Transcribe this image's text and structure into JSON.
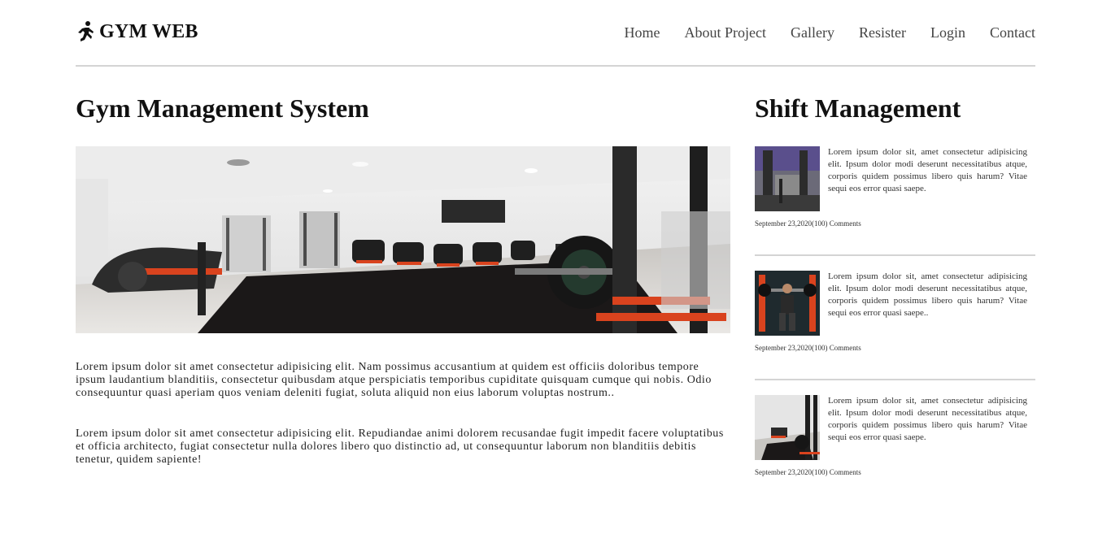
{
  "header": {
    "brand": "GYM WEB",
    "brand_icon": "running-person-icon",
    "nav": [
      "Home",
      "About Project",
      "Gallery",
      "Resister",
      "Login",
      "Contact"
    ]
  },
  "main": {
    "title": "Gym Management System",
    "paragraphs": [
      "Lorem ipsum dolor sit amet consectetur adipisicing elit. Nam possimus accusantium at quidem est officiis doloribus tempore ipsum laudantium blanditiis, consectetur quibusdam atque perspiciatis temporibus cupiditate quisquam cumque qui nobis. Odio consequuntur quasi aperiam quos veniam deleniti fugiat, soluta aliquid non eius laborum voluptas nostrum..",
      "Lorem ipsum dolor sit amet consectetur adipisicing elit. Repudiandae animi dolorem recusandae fugit impedit facere voluptatibus et officia architecto, fugiat consectetur nulla dolores libero quo distinctio ad, ut consequuntur laborum non blanditiis debitis tenetur, quidem sapiente!"
    ]
  },
  "sidebar": {
    "title": "Shift Management",
    "posts": [
      {
        "text": "Lorem ipsum dolor sit, amet consectetur adipisicing elit. Ipsum dolor modi deserunt necessitatibus atque, corporis quidem possimus libero quis harum? Vitae sequi eos error quasi saepe.",
        "meta": "September 23,2020(100) Comments"
      },
      {
        "text": "Lorem ipsum dolor sit, amet consectetur adipisicing elit. Ipsum dolor modi deserunt necessitatibus atque, corporis quidem possimus libero quis harum? Vitae sequi eos error quasi saepe..",
        "meta": "September 23,2020(100) Comments"
      },
      {
        "text": "Lorem ipsum dolor sit, amet consectetur adipisicing elit. Ipsum dolor modi deserunt necessitatibus atque, corporis quidem possimus libero quis harum? Vitae sequi eos error quasi saepe.",
        "meta": "September 23,2020(100) Comments"
      }
    ]
  },
  "colors": {
    "text": "#111111",
    "nav_link": "#444444",
    "divider": "#d4d4d4",
    "equipment_accent": "#d9431e"
  }
}
